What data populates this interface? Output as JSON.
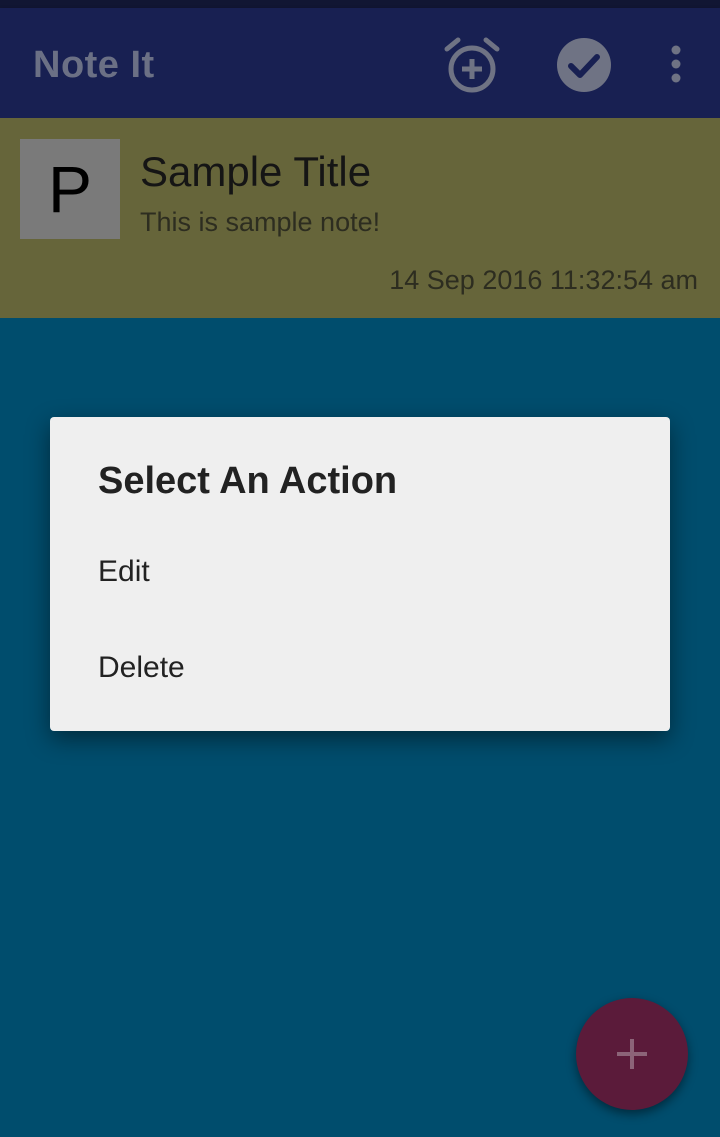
{
  "app": {
    "title": "Note It"
  },
  "toolbar": {
    "icons": [
      "add-alarm-icon",
      "check-circle-icon",
      "more-vert-icon"
    ]
  },
  "note": {
    "avatar_letter": "P",
    "title": "Sample Title",
    "body": "This is sample note!",
    "date": "14 Sep 2016 11:32:54 am"
  },
  "dialog": {
    "title": "Select An Action",
    "items": [
      {
        "label": "Edit"
      },
      {
        "label": "Delete"
      }
    ]
  },
  "fab": {
    "icon": "plus-icon"
  },
  "colors": {
    "background": "#004d6d",
    "appbar": "#182052",
    "note_card": "#66653a",
    "dialog": "#efefef",
    "fab": "#5b1b3a"
  }
}
